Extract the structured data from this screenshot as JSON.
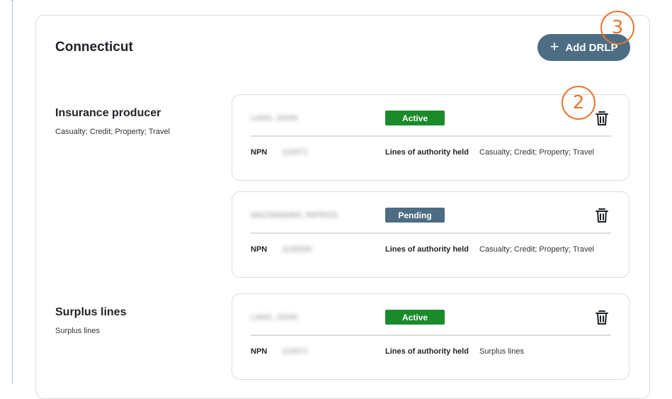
{
  "state": {
    "title": "Connecticut"
  },
  "add_button": {
    "label": "Add DRLP",
    "icon": "plus-icon"
  },
  "markers": {
    "marker_3": "3",
    "marker_2": "2"
  },
  "colors": {
    "active": "#1a8a2a",
    "pending": "#4c6d83",
    "marker": "#e6762f",
    "button": "#4c6d83"
  },
  "sections": [
    {
      "title": "Insurance producer",
      "subtitle": "Casualty; Credit; Property; Travel",
      "entries": [
        {
          "name": "LANG, JOHN",
          "status": "Active",
          "npn_label": "NPN",
          "npn_value": "123471",
          "loa_label": "Lines of authority held",
          "loa_value": "Casualty; Credit; Property; Travel"
        },
        {
          "name": "MACNAMARA, PATRICK",
          "status": "Pending",
          "npn_label": "NPN",
          "npn_value": "1128290",
          "loa_label": "Lines of authority held",
          "loa_value": "Casualty; Credit; Property; Travel"
        }
      ]
    },
    {
      "title": "Surplus lines",
      "subtitle": "Surplus lines",
      "entries": [
        {
          "name": "LANG, JOHN",
          "status": "Active",
          "npn_label": "NPN",
          "npn_value": "123471",
          "loa_label": "Lines of authority held",
          "loa_value": "Surplus lines"
        }
      ]
    }
  ]
}
